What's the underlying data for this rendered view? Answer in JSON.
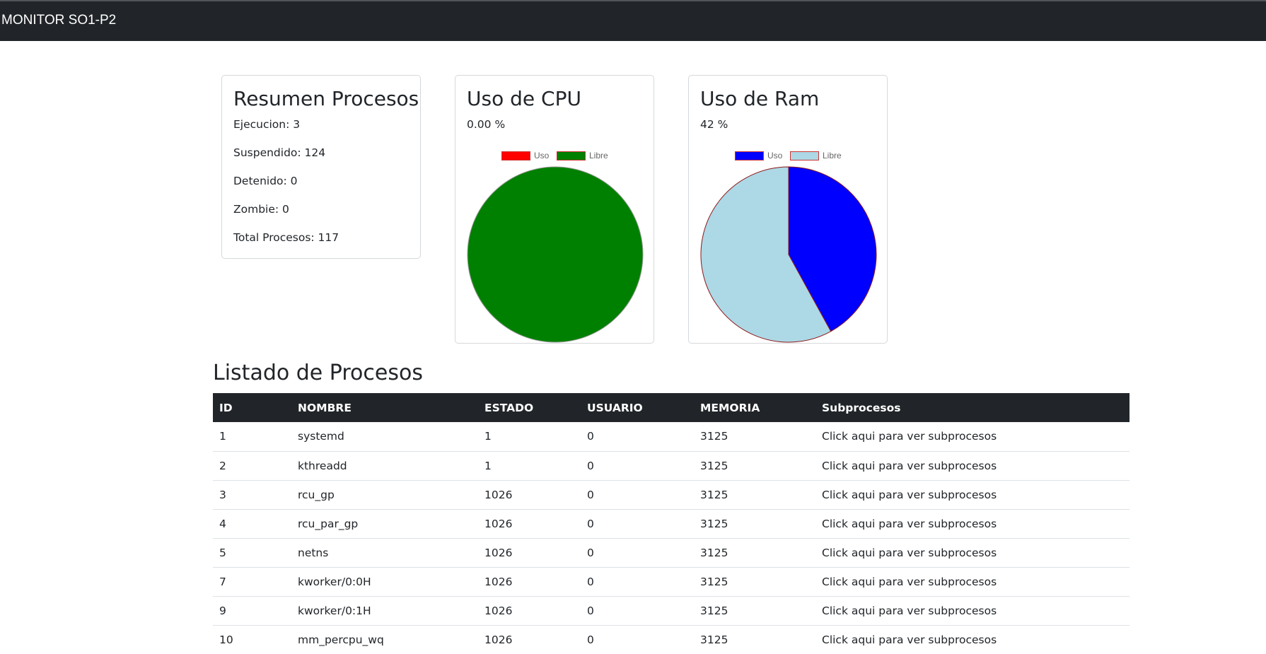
{
  "navbar": {
    "brand": "MONITOR SO1-P2"
  },
  "summary": {
    "title": "Resumen Procesos",
    "items": [
      {
        "label": "Ejecucion: 3"
      },
      {
        "label": "Suspendido: 124"
      },
      {
        "label": "Detenido: 0"
      },
      {
        "label": "Zombie: 0"
      },
      {
        "label": "Total Procesos: 117"
      }
    ]
  },
  "cpu": {
    "title": "Uso de CPU",
    "value_text": "0.00 %",
    "legend": [
      "Uso",
      "Libre"
    ]
  },
  "ram": {
    "title": "Uso de Ram",
    "value_text": "42 %",
    "legend": [
      "Uso",
      "Libre"
    ]
  },
  "colors": {
    "navbar": "#212529",
    "cpu_uso": "#ff0000",
    "cpu_libre": "#008000",
    "ram_uso": "#0000ff",
    "ram_libre": "#add8e6"
  },
  "chart_data": [
    {
      "type": "pie",
      "title": "Uso de CPU",
      "categories": [
        "Uso",
        "Libre"
      ],
      "values": [
        0,
        100
      ],
      "colors": [
        "#ff0000",
        "#008000"
      ],
      "legend": "top"
    },
    {
      "type": "pie",
      "title": "Uso de Ram",
      "categories": [
        "Uso",
        "Libre"
      ],
      "values": [
        42,
        58
      ],
      "colors": [
        "#0000ff",
        "#add8e6"
      ],
      "legend": "top"
    }
  ],
  "processes": {
    "title": "Listado de Procesos",
    "headers": [
      "ID",
      "NOMBRE",
      "ESTADO",
      "USUARIO",
      "MEMORIA",
      "Subprocesos"
    ],
    "rows": [
      {
        "id": "1",
        "nombre": "systemd",
        "estado": "1",
        "usuario": "0",
        "memoria": "3125",
        "sub": "Click aqui para ver subprocesos"
      },
      {
        "id": "2",
        "nombre": "kthreadd",
        "estado": "1",
        "usuario": "0",
        "memoria": "3125",
        "sub": "Click aqui para ver subprocesos"
      },
      {
        "id": "3",
        "nombre": "rcu_gp",
        "estado": "1026",
        "usuario": "0",
        "memoria": "3125",
        "sub": "Click aqui para ver subprocesos"
      },
      {
        "id": "4",
        "nombre": "rcu_par_gp",
        "estado": "1026",
        "usuario": "0",
        "memoria": "3125",
        "sub": "Click aqui para ver subprocesos"
      },
      {
        "id": "5",
        "nombre": "netns",
        "estado": "1026",
        "usuario": "0",
        "memoria": "3125",
        "sub": "Click aqui para ver subprocesos"
      },
      {
        "id": "7",
        "nombre": "kworker/0:0H",
        "estado": "1026",
        "usuario": "0",
        "memoria": "3125",
        "sub": "Click aqui para ver subprocesos"
      },
      {
        "id": "9",
        "nombre": "kworker/0:1H",
        "estado": "1026",
        "usuario": "0",
        "memoria": "3125",
        "sub": "Click aqui para ver subprocesos"
      },
      {
        "id": "10",
        "nombre": "mm_percpu_wq",
        "estado": "1026",
        "usuario": "0",
        "memoria": "3125",
        "sub": "Click aqui para ver subprocesos"
      }
    ]
  }
}
